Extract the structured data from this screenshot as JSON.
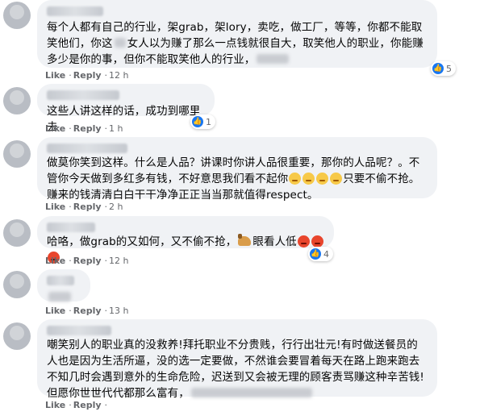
{
  "actions": {
    "like": "Like",
    "reply": "Reply",
    "sep": "·"
  },
  "comments": [
    {
      "text_a": "每个人都有自己的行业，架grab，架lory，卖吃，做工厂，等等，你都不能取笑他们，你这",
      "text_b": "女人以为赚了那么一点钱就很自大，取笑他人的职业，你能赚多少是你的事，但你不能取笑他人的行业，",
      "time": "12 h",
      "reactions": {
        "icon": "like-icon",
        "count": "5"
      }
    },
    {
      "text": "这些人讲这样的话，成功到哪里去",
      "time": "1 h",
      "reactions": {
        "icon": "like-icon",
        "count": "1"
      }
    },
    {
      "text_a": "做莫你笑到这样。什么是人品？讲课时你讲人品很重要，那你的人品呢？。不管你今天做到多红多有钱，不好意思我们看不起你",
      "text_b": "只要不偷不抢。赚来的钱清清白白干干净净正正当当那就值得respect。",
      "time": "2 h",
      "reactions": null
    },
    {
      "text_a": "哈咯，做grab的又如何，又不偷不抢，",
      "text_b": "眼看人低",
      "time": "12 h",
      "reactions": {
        "icon": "like-icon",
        "count": "4"
      }
    },
    {
      "text": "",
      "time": "13 h",
      "reactions": null
    },
    {
      "text_a": "嘲笑别人的职业真的没救养!拜托职业不分贵贱，行行出壮元!有时做送餐员的人也是因为生活所逼，没的选一定要做，不然谁会要冒着每天在路上跑来跑去不知几时会遇到意外的生命危险，迟送到又会被无理的顾客责骂赚这种辛苦钱!但愿你世世代代都那么富有，",
      "time": "",
      "reactions": null
    }
  ],
  "colors": {
    "bubble": "#f0f2f5",
    "meta": "#65676b",
    "like_blue": "#1877f2"
  }
}
